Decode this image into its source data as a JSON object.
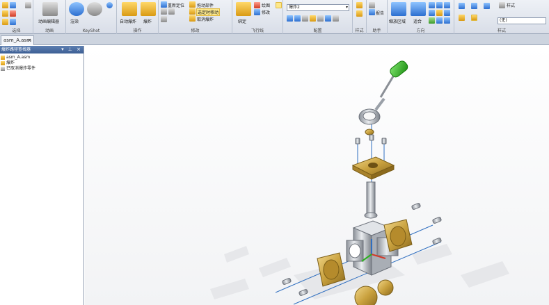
{
  "ribbon": {
    "groups": {
      "select": "选择",
      "animation": "动画",
      "keyshot": "KeyShot",
      "operation": "操作",
      "modify": "修改",
      "flyline": "飞行线",
      "config": "配置",
      "pattern": "样式",
      "assistant": "助手",
      "direction": "方向",
      "style": "样式"
    },
    "buttons": {
      "animation_editor": "动画编辑器",
      "keyshot_render": "渲染",
      "auto_explode": "自动爆炸",
      "explode": "爆炸",
      "reposition": "重新定位",
      "drag_component": "拖动部件",
      "move_with_components": "选定时移动",
      "unexplode": "取消爆炸",
      "bind": "绑定",
      "draw": "绘图",
      "edit": "修改",
      "report": "报告",
      "zoom_area": "缩放区域",
      "fit": "适合",
      "style_label": "样式",
      "style_value": "(无)"
    },
    "config_combo": "爆炸2"
  },
  "document_tab": {
    "label": "asm_A.asm",
    "close": "×"
  },
  "pane": {
    "title": "爆炸路径查找器",
    "buttons": "▾ ⊥ ×",
    "tree": [
      {
        "label": "asm_A.asm"
      },
      {
        "label": "爆炸"
      },
      {
        "label": "已取消爆炸零件"
      }
    ]
  },
  "colors": {
    "brass": "#c9a13e",
    "steel": "#b7bcc3",
    "green_handle": "#2bb21e",
    "flyline": "#2f6fc0"
  }
}
